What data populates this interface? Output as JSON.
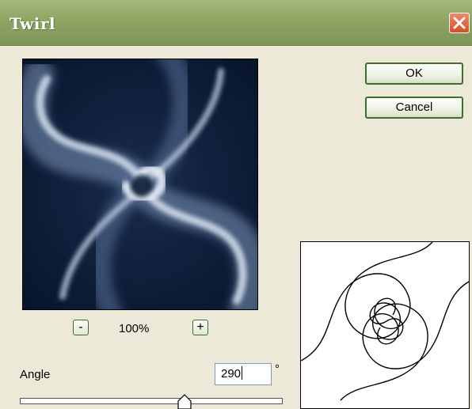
{
  "window": {
    "title": "Twirl"
  },
  "buttons": {
    "ok_label": "OK",
    "cancel_label": "Cancel"
  },
  "zoom": {
    "minus_label": "-",
    "plus_label": "+",
    "level": "100%"
  },
  "angle": {
    "label": "Angle",
    "value": "290",
    "unit": "°",
    "slider_fraction": 0.625
  },
  "colors": {
    "titlebar": "#8ea563",
    "dialog_bg": "#ece9d8",
    "button_border": "#3d6e2b",
    "close_button": "#e0643a"
  },
  "icons": {
    "close": "close-x-icon",
    "zoom_out": "minus-icon",
    "zoom_in": "plus-icon"
  }
}
